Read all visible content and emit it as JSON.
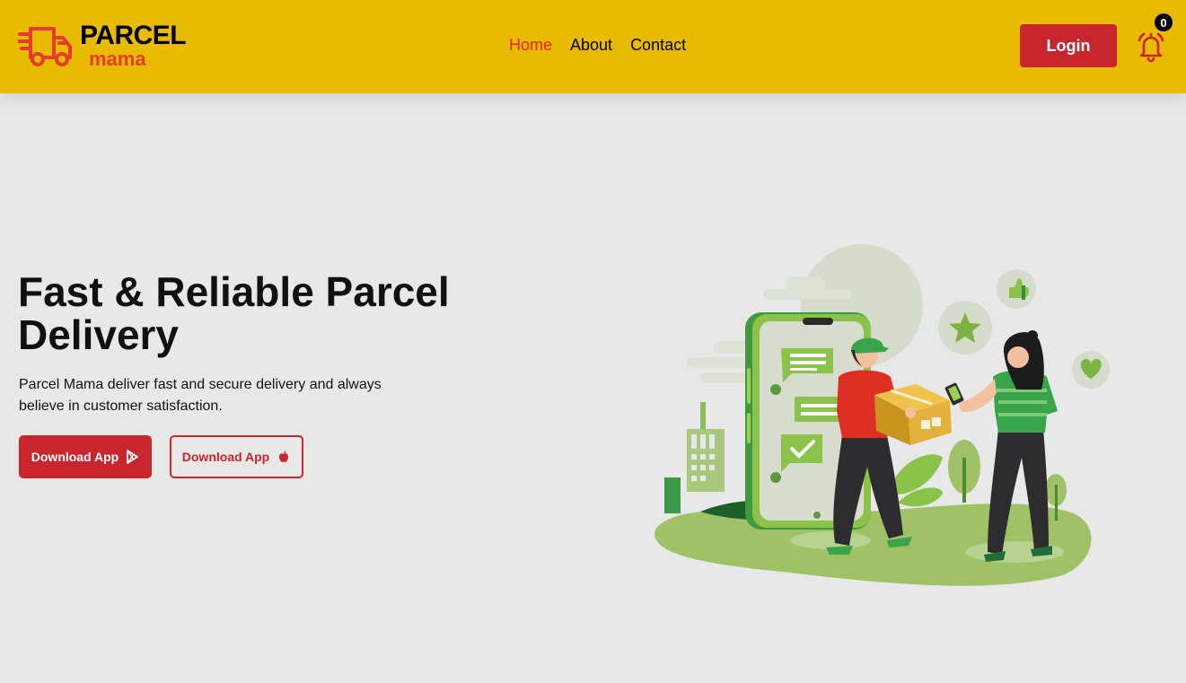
{
  "header": {
    "logo": {
      "top": "PARCEL",
      "bottom": "mama"
    },
    "nav": [
      {
        "label": "Home",
        "active": true
      },
      {
        "label": "About",
        "active": false
      },
      {
        "label": "Contact",
        "active": false
      }
    ],
    "login_label": "Login",
    "notification_count": "0"
  },
  "hero": {
    "title": "Fast & Reliable Parcel Delivery",
    "description": "Parcel Mama deliver fast and secure delivery and always believe in customer satisfaction.",
    "buttons": {
      "android": {
        "label": "Download App",
        "icon": "google-play-icon"
      },
      "ios": {
        "label": "Download App",
        "icon": "apple-icon"
      }
    }
  },
  "colors": {
    "header_bg": "#e8bb00",
    "accent_red": "#c9252c",
    "active_link": "#e8230f",
    "page_bg": "#e8e8e8",
    "illustration_green": "#8bc34a"
  }
}
